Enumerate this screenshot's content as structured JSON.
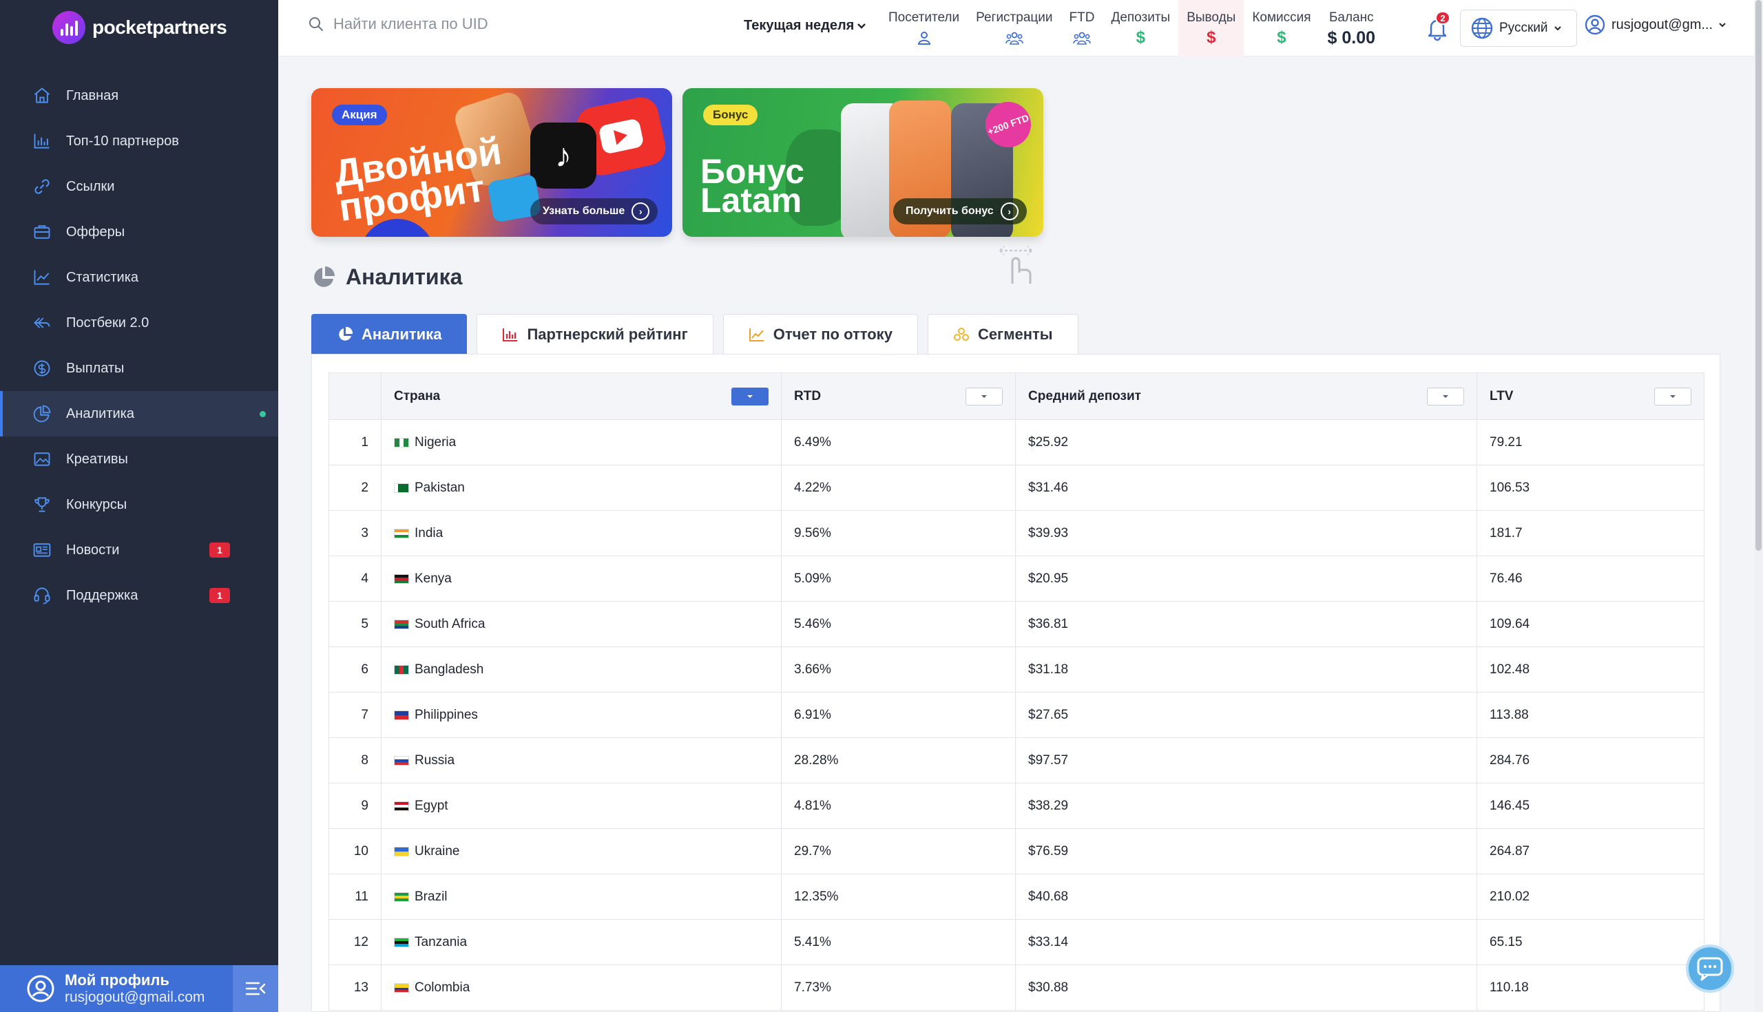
{
  "brand": {
    "name": "pocketpartners"
  },
  "sidebar": {
    "items": [
      {
        "label": "Главная",
        "icon": "home-icon"
      },
      {
        "label": "Топ-10 партнеров",
        "icon": "bar-chart-icon"
      },
      {
        "label": "Ссылки",
        "icon": "link-icon"
      },
      {
        "label": "Офферы",
        "icon": "briefcase-icon"
      },
      {
        "label": "Статистика",
        "icon": "line-chart-icon"
      },
      {
        "label": "Постбеки 2.0",
        "icon": "postback-icon"
      },
      {
        "label": "Выплаты",
        "icon": "coin-icon"
      },
      {
        "label": "Аналитика",
        "icon": "analytics-icon",
        "active": true
      },
      {
        "label": "Креативы",
        "icon": "image-icon"
      },
      {
        "label": "Конкурсы",
        "icon": "trophy-icon"
      },
      {
        "label": "Новости",
        "icon": "news-icon",
        "badge": "1"
      },
      {
        "label": "Поддержка",
        "icon": "support-icon",
        "badge": "1"
      }
    ],
    "profile": {
      "name": "Мой профиль",
      "email": "rusjogout@gmail.com"
    }
  },
  "topbar": {
    "search_placeholder": "Найти клиента по UID",
    "period": "Текущая неделя",
    "stats": [
      {
        "label": "Посетители",
        "icon": "user-icon"
      },
      {
        "label": "Регистрации",
        "icon": "users-icon"
      },
      {
        "label": "FTD",
        "icon": "users-icon"
      },
      {
        "label": "Депозиты",
        "icon": "dollar-icon",
        "value": "$",
        "color": "#2fb87a"
      },
      {
        "label": "Выводы",
        "icon": "dollar-icon",
        "value": "$",
        "color": "#e0283a"
      },
      {
        "label": "Комиссия",
        "icon": "dollar-icon",
        "value": "$",
        "color": "#2fb87a"
      },
      {
        "label": "Баланс",
        "value": "$ 0.00"
      }
    ],
    "notifications_count": "2",
    "language": "Русский",
    "user": "rusjogout@gm..."
  },
  "banners": [
    {
      "tag": "Акция",
      "title": "Двойной\nпрофит",
      "button": "Узнать больше"
    },
    {
      "tag": "Бонус",
      "title": "Бонус\nLatam",
      "button": "Получить бонус",
      "sticker": "+200 FTD"
    }
  ],
  "section": {
    "title": "Аналитика"
  },
  "tabs": [
    {
      "label": "Аналитика",
      "icon": "pie-chart-icon",
      "active": true
    },
    {
      "label": "Партнерский рейтинг",
      "icon": "bar-chart-icon"
    },
    {
      "label": "Отчет по оттоку",
      "icon": "line-chart-icon"
    },
    {
      "label": "Сегменты",
      "icon": "segments-icon"
    }
  ],
  "table": {
    "columns": [
      "Страна",
      "RTD",
      "Средний депозит",
      "LTV"
    ],
    "rows": [
      {
        "n": "1",
        "country": "Nigeria",
        "rtd": "6.49%",
        "avg": "$25.92",
        "ltv": "79.21",
        "flag": [
          "#1f8a3d",
          "#ffffff",
          "#1f8a3d"
        ],
        "flag_dir": "v"
      },
      {
        "n": "2",
        "country": "Pakistan",
        "rtd": "4.22%",
        "avg": "$31.46",
        "ltv": "106.53",
        "flag": [
          "#ffffff",
          "#0b6b2e",
          "#0b6b2e",
          "#0b6b2e"
        ],
        "flag_dir": "v"
      },
      {
        "n": "3",
        "country": "India",
        "rtd": "9.56%",
        "avg": "$39.93",
        "ltv": "181.7",
        "flag": [
          "#f39a33",
          "#ffffff",
          "#1a8a3a"
        ],
        "flag_dir": "h"
      },
      {
        "n": "4",
        "country": "Kenya",
        "rtd": "5.09%",
        "avg": "$20.95",
        "ltv": "76.46",
        "flag": [
          "#111111",
          "#c0232e",
          "#1a7a3a"
        ],
        "flag_dir": "h"
      },
      {
        "n": "5",
        "country": "South Africa",
        "rtd": "5.46%",
        "avg": "$36.81",
        "ltv": "109.64",
        "flag": [
          "#d6322d",
          "#1d8a4a",
          "#1f3d8f"
        ],
        "flag_dir": "h"
      },
      {
        "n": "6",
        "country": "Bangladesh",
        "rtd": "3.66%",
        "avg": "$31.18",
        "ltv": "102.48",
        "flag": [
          "#0a6b48",
          "#d62a34",
          "#0a6b48"
        ],
        "flag_dir": "v"
      },
      {
        "n": "7",
        "country": "Philippines",
        "rtd": "6.91%",
        "avg": "$27.65",
        "ltv": "113.88",
        "flag": [
          "#1f3fa0",
          "#d6262e"
        ],
        "flag_dir": "h"
      },
      {
        "n": "8",
        "country": "Russia",
        "rtd": "28.28%",
        "avg": "$97.57",
        "ltv": "284.76",
        "flag": [
          "#ffffff",
          "#1f46b5",
          "#d6262e"
        ],
        "flag_dir": "h"
      },
      {
        "n": "9",
        "country": "Egypt",
        "rtd": "4.81%",
        "avg": "$38.29",
        "ltv": "146.45",
        "flag": [
          "#ce1126",
          "#ffffff",
          "#111111"
        ],
        "flag_dir": "h"
      },
      {
        "n": "10",
        "country": "Ukraine",
        "rtd": "29.7%",
        "avg": "$76.59",
        "ltv": "264.87",
        "flag": [
          "#2f6ad0",
          "#f5d22a"
        ],
        "flag_dir": "h"
      },
      {
        "n": "11",
        "country": "Brazil",
        "rtd": "12.35%",
        "avg": "$40.68",
        "ltv": "210.02",
        "flag": [
          "#1f9a40",
          "#f2d21f",
          "#1f9a40"
        ],
        "flag_dir": "h"
      },
      {
        "n": "12",
        "country": "Tanzania",
        "rtd": "5.41%",
        "avg": "$33.14",
        "ltv": "65.15",
        "flag": [
          "#1eb53a",
          "#111111",
          "#00a3dd"
        ],
        "flag_dir": "h"
      },
      {
        "n": "13",
        "country": "Colombia",
        "rtd": "7.73%",
        "avg": "$30.88",
        "ltv": "110.18",
        "flag": [
          "#f5d21f",
          "#f5d21f",
          "#1f3fa0",
          "#d6262e"
        ],
        "flag_dir": "h"
      }
    ]
  }
}
